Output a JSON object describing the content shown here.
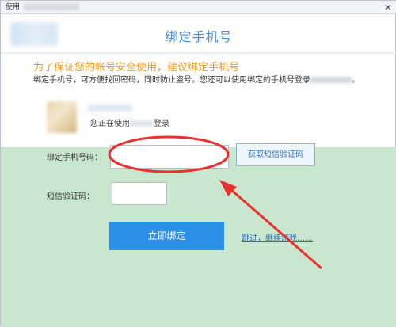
{
  "titlebar": {
    "title": "使用",
    "close_glyph": "×"
  },
  "header": {
    "title": "绑定手机号"
  },
  "notice": {
    "title": "为了保证您的帐号安全使用，建议绑定手机号",
    "desc_prefix": "绑定手机号，可方便找回密码，同时防止盗号。您还可以使用绑定的手机号登录",
    "desc_suffix": "。"
  },
  "user": {
    "status_prefix": "您正在使用",
    "status_suffix": "登录"
  },
  "form": {
    "phone_label": "绑定手机号码：",
    "phone_value": "",
    "get_code_label": "获取短信验证码",
    "code_label": "短信验证码：",
    "code_value": "",
    "bind_label": "立即绑定",
    "skip_label": "跳过，继续游戏……"
  },
  "annotation": {
    "color": "#e8322f"
  },
  "colors": {
    "accent_blue": "#2b8fe6",
    "title_blue": "#4a8fd6",
    "notice_orange": "#f39a1a",
    "green_bg": "#c9e7cf"
  }
}
